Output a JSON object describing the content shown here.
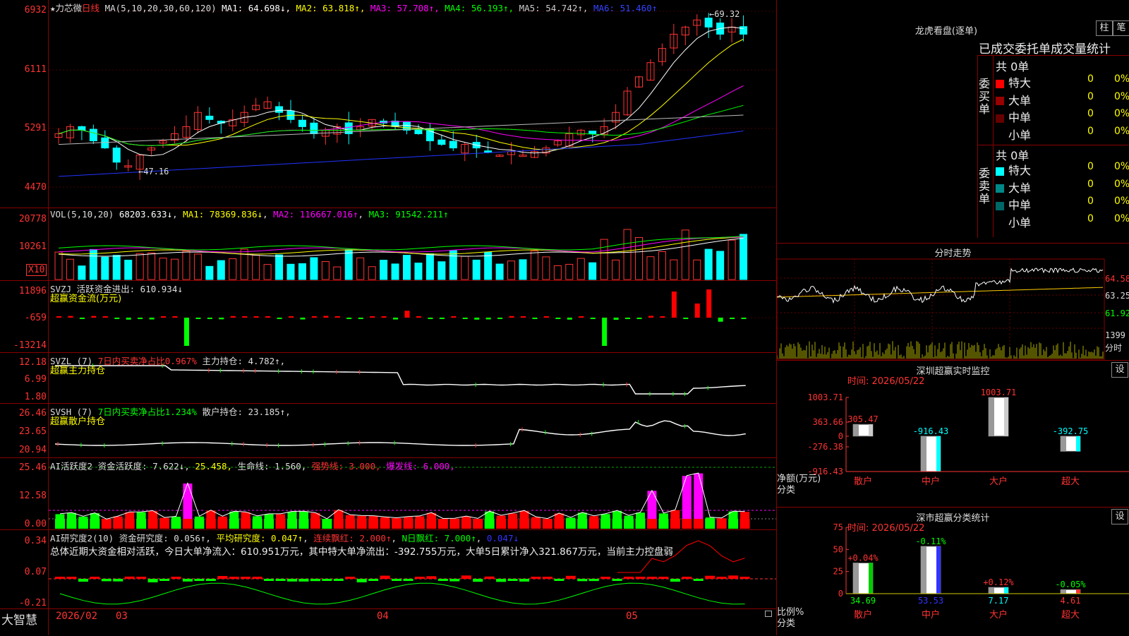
{
  "kline": {
    "title_star": "★力芯微",
    "period": "日线",
    "ma_params": "MA(5,10,20,30,60,120)",
    "ma": [
      {
        "label": "MA1: 64.698↓",
        "color": "#ffffff"
      },
      {
        "label": "MA2: 63.818↑",
        "color": "#ffff00"
      },
      {
        "label": "MA3: 57.708↑",
        "color": "#ff00ff"
      },
      {
        "label": "MA4: 56.193↑",
        "color": "#00ff00"
      },
      {
        "label": "MA5: 54.742↑",
        "color": "#cccccc"
      },
      {
        "label": "MA6: 51.460↑",
        "color": "#3344ff"
      }
    ],
    "yticks": [
      "6932",
      "6111",
      "5291",
      "4470"
    ],
    "max_label": "69.32",
    "min_label": "47.16"
  },
  "vol": {
    "header": "VOL(5,10,20)",
    "value": "68203.633↓",
    "ma1": "MA1: 78369.836↓",
    "ma2": "MA2: 116667.016↑",
    "ma3": "MA3: 91542.211↑",
    "yticks": [
      "20778",
      "10261"
    ],
    "unit": "X10"
  },
  "svzj": {
    "header": "SVZJ  活跃资金进出: 610.934↓",
    "sub": "超赢资金流(万元)",
    "yticks": [
      "11896",
      "-659",
      "-13214"
    ]
  },
  "svzl": {
    "header_a": "SVZL (7)",
    "header_b": "7日内买卖净占比0.967%",
    "header_c": "主力持仓: 4.782↑,",
    "sub": "超赢主力持仓",
    "yticks": [
      "12.18",
      "6.99",
      "1.80"
    ]
  },
  "svsh": {
    "header_a": "SVSH (7)",
    "header_b": "7日内买卖净占比1.234%",
    "header_c": "散户持仓: 23.185↑,",
    "sub": "超赢散户持仓",
    "yticks": [
      "26.46",
      "23.65",
      "20.94"
    ]
  },
  "ai_active": {
    "h1": "AI活跃度2 资金活跃度: 7.622↓",
    "h2": "25.458,",
    "h3": "生命线: 1.560,",
    "h4": "强势线: 3.000,",
    "h5": "爆发线: 6.000,",
    "yticks": [
      "25.46",
      "12.58",
      "0.00"
    ]
  },
  "ai_research": {
    "h1": "AI研究度2(10) 资金研究度: 0.056↑",
    "h2": "平均研究度: 0.047↑",
    "h3": "连续飘红: 2.000↑",
    "h4": "N日飘红: 7.000↑",
    "h5": "0.047↓",
    "summary": "总体近期大资金相对活跃，今日大单净流入：610.951万元，其中特大单净流出：-392.755万元，大单5日累计净入321.867万元，当前主力控盘弱",
    "yticks": [
      "0.34",
      "0.07",
      "-0.21"
    ]
  },
  "footer": {
    "brand": "大智慧",
    "dates": [
      "2026/02",
      "03",
      "04",
      "05"
    ]
  },
  "dragon": {
    "title": "龙虎看盘(逐单)",
    "btn1": "柱",
    "btn2": "笔",
    "heading": "已成交委托单成交量统计",
    "buy_label": "委买单",
    "sell_label": "委卖单",
    "buy_total": "共 0单",
    "sell_total": "共 0单",
    "buy_rows": [
      {
        "name": "特大",
        "count": "0",
        "pct": "0%",
        "color": "#ff0000"
      },
      {
        "name": "大单",
        "count": "0",
        "pct": "0%",
        "color": "#990000"
      },
      {
        "name": "中单",
        "count": "0",
        "pct": "0%",
        "color": "#660000"
      },
      {
        "name": "小单",
        "count": "0",
        "pct": "0%",
        "color": "#000000"
      }
    ],
    "sell_rows": [
      {
        "name": "特大",
        "count": "0",
        "pct": "0%",
        "color": "#00ffff"
      },
      {
        "name": "大单",
        "count": "0",
        "pct": "0%",
        "color": "#008888"
      },
      {
        "name": "中单",
        "count": "0",
        "pct": "0%",
        "color": "#006666"
      },
      {
        "name": "小单",
        "count": "0",
        "pct": "0%",
        "color": "#000000"
      }
    ]
  },
  "intraday": {
    "title": "分时走势",
    "yticks": [
      "64.58",
      "63.25",
      "61.92"
    ],
    "vol_tick": "1399",
    "vol_unit": "分时"
  },
  "sz_monitor": {
    "title": "深圳超赢实时监控",
    "btn": "设",
    "time": "时间: 2026/05/22",
    "yticks": [
      "1003.71",
      "363.66",
      "0",
      "-276.38",
      "-916.43"
    ],
    "ylabel": "净额(万元)",
    "xlabel": "分类",
    "bars": [
      {
        "cat": "散户",
        "value": 305.47,
        "label": "305.47"
      },
      {
        "cat": "中户",
        "value": -916.43,
        "label": "-916.43"
      },
      {
        "cat": "大户",
        "value": 1003.71,
        "label": "1003.71"
      },
      {
        "cat": "超大",
        "value": -392.75,
        "label": "-392.75"
      }
    ]
  },
  "sz_class": {
    "title": "深市超赢分类统计",
    "btn": "设",
    "time": "时间: 2026/05/22",
    "yticks": [
      "75",
      "50",
      "25",
      "0"
    ],
    "ylabel": "比例%",
    "xlabel": "分类",
    "bars": [
      {
        "cat": "散户",
        "value": 34.69,
        "label": "34.69",
        "change": "+0.04%"
      },
      {
        "cat": "中户",
        "value": 53.53,
        "label": "53.53",
        "change": "-0.11%"
      },
      {
        "cat": "大户",
        "value": 7.17,
        "label": "7.17",
        "change": "+0.12%"
      },
      {
        "cat": "超大",
        "value": 4.61,
        "label": "4.61",
        "change": "-0.05%"
      }
    ]
  },
  "chart_data": [
    {
      "type": "bar",
      "title": "深圳超赢实时监控",
      "categories": [
        "散户",
        "中户",
        "大户",
        "超大"
      ],
      "values": [
        305.47,
        -916.43,
        1003.71,
        -392.75
      ],
      "ylabel": "净额(万元)",
      "ylim": [
        -916.43,
        1003.71
      ]
    },
    {
      "type": "bar",
      "title": "深市超赢分类统计",
      "categories": [
        "散户",
        "中户",
        "大户",
        "超大"
      ],
      "values": [
        34.69,
        53.53,
        7.17,
        4.61
      ],
      "ylabel": "比例%",
      "ylim": [
        0,
        75
      ]
    }
  ]
}
